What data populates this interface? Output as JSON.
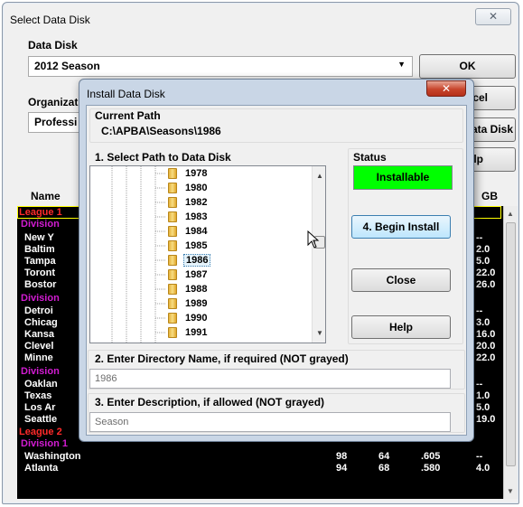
{
  "main_window": {
    "title": "Select Data Disk",
    "close_glyph": "✕",
    "data_disk_label": "Data Disk",
    "data_disk_value": "2012  Season",
    "organization_label": "Organizat",
    "organization_value": "Professi",
    "ok_label": "OK",
    "cancel_label": "cel",
    "install_label": "ata Disk",
    "help_label": "lp"
  },
  "grid": {
    "name_header": "Name",
    "gb_header": "GB",
    "rows": [
      {
        "kind": "league",
        "text": "League 1",
        "gb": ""
      },
      {
        "kind": "division",
        "text": "Division",
        "gb": ""
      },
      {
        "kind": "team",
        "text": "New Y",
        "gb": "--"
      },
      {
        "kind": "team",
        "text": "Baltim",
        "gb": "2.0"
      },
      {
        "kind": "team",
        "text": "Tampa",
        "gb": "5.0"
      },
      {
        "kind": "team",
        "text": "Toront",
        "gb": "22.0"
      },
      {
        "kind": "team",
        "text": "Bostor",
        "gb": "26.0"
      },
      {
        "kind": "division",
        "text": "Division",
        "gb": ""
      },
      {
        "kind": "team",
        "text": "Detroi",
        "gb": "--"
      },
      {
        "kind": "team",
        "text": "Chicag",
        "gb": "3.0"
      },
      {
        "kind": "team",
        "text": "Kansa",
        "gb": "16.0"
      },
      {
        "kind": "team",
        "text": "Clevel",
        "gb": "20.0"
      },
      {
        "kind": "team",
        "text": "Minne",
        "gb": "22.0"
      },
      {
        "kind": "division",
        "text": "Division",
        "gb": ""
      },
      {
        "kind": "team",
        "text": "Oaklan",
        "gb": "--"
      },
      {
        "kind": "team",
        "text": "Texas",
        "gb": "1.0"
      },
      {
        "kind": "team",
        "text": "Los Ar",
        "gb": "5.0"
      },
      {
        "kind": "team",
        "text": "Seattle",
        "gb": "19.0"
      },
      {
        "kind": "league",
        "text": "League 2",
        "gb": ""
      },
      {
        "kind": "division",
        "text": "Division 1",
        "gb": ""
      },
      {
        "kind": "team",
        "text": "Washington",
        "w": "98",
        "l": "64",
        "pct": ".605",
        "gb": "--"
      },
      {
        "kind": "team",
        "text": "Atlanta",
        "w": "94",
        "l": "68",
        "pct": ".580",
        "gb": "4.0"
      }
    ]
  },
  "install_dialog": {
    "title": "Install Data Disk",
    "close_glyph": "✕",
    "current_path_label": "Current Path",
    "current_path_value": "C:\\APBA\\Seasons\\1986",
    "select_path_label": "1. Select Path to Data Disk",
    "status_label": "Status",
    "status_value": "Installable",
    "status_color": "#00ff00",
    "tree_items": [
      "1978",
      "1980",
      "1982",
      "1983",
      "1984",
      "1985",
      "1986",
      "1987",
      "1988",
      "1989",
      "1990",
      "1991"
    ],
    "selected_item": "1986",
    "begin_install_label": "4. Begin Install",
    "close_label": "Close",
    "help_label": "Help",
    "dir_name_label": "2. Enter Directory Name, if required (NOT grayed)",
    "dir_name_value": "1986",
    "description_label": "3. Enter Description, if allowed (NOT grayed)",
    "description_value": "Season"
  }
}
